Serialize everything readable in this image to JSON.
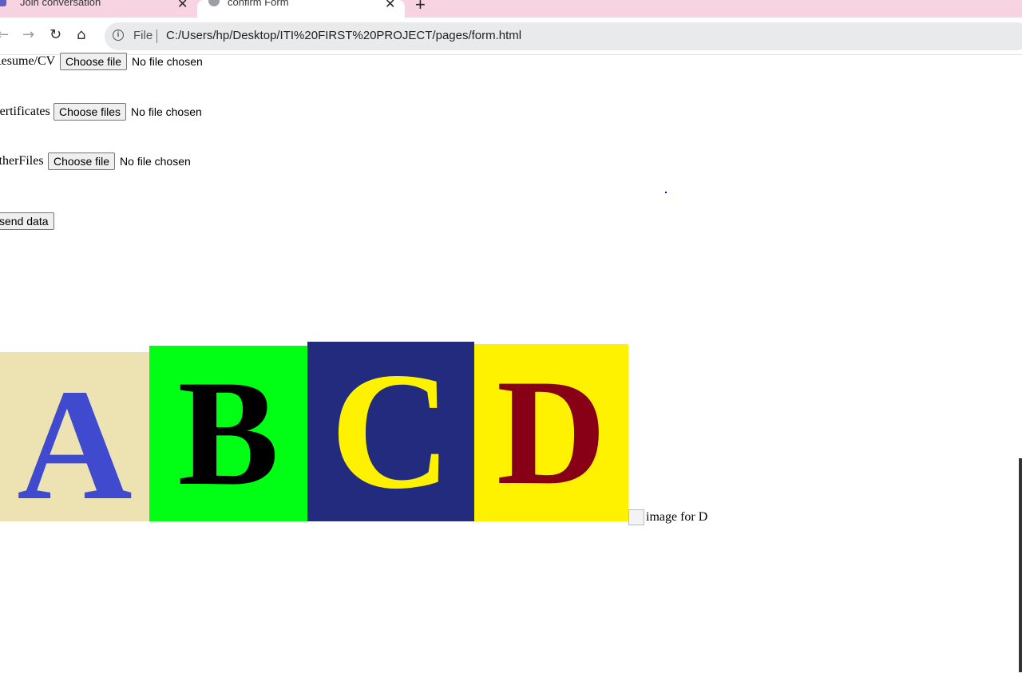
{
  "browser": {
    "tabs": [
      {
        "label": "Join conversation",
        "active": false
      },
      {
        "label": "confirm Form",
        "active": true
      }
    ],
    "address": {
      "scheme": "File",
      "url": "C:/Users/hp/Desktop/ITI%20FIRST%20PROJECT/pages/form.html"
    },
    "nav_icons": [
      "back-icon",
      "forward-icon",
      "reload-icon",
      "home-icon",
      "info-icon"
    ]
  },
  "form": {
    "resume_label": "Resume/CV",
    "resume_button": "Choose file",
    "resume_status": "No file chosen",
    "certificates_label": "Certificates",
    "certificates_button": "Choose files",
    "certificates_status": "No file chosen",
    "other_label": "OtherFiles",
    "other_button": "Choose file",
    "other_status": "No file chosen",
    "send_button": "send data"
  },
  "images": {
    "a_letter": "A",
    "b_letter": "B",
    "c_letter": "C",
    "d_letter": "D",
    "d_alt": "image for D",
    "colors": {
      "a_bg": "#ede3b2",
      "a_fg": "#3f4acf",
      "b_bg": "#00ff14",
      "b_fg": "#000000",
      "c_bg": "#222b7e",
      "c_fg": "#fff200",
      "d_bg": "#fff200",
      "d_fg": "#870016"
    }
  }
}
